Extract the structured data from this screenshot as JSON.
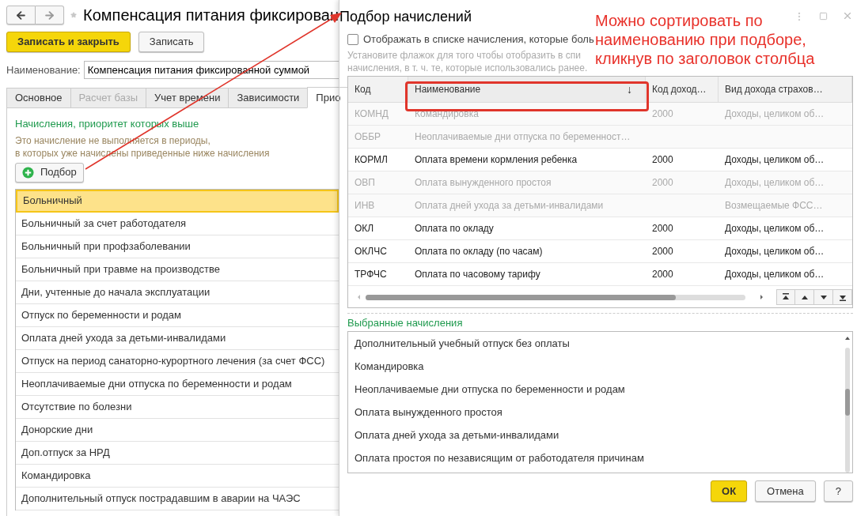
{
  "form": {
    "title": "Компенсация питания фиксирован",
    "buttons": [
      {
        "label": "Записать и закрыть",
        "kind": "primary"
      },
      {
        "label": "Записать",
        "kind": "normal"
      }
    ],
    "name_field": {
      "label": "Наименование:",
      "value": "Компенсация питания фиксированной суммой"
    },
    "tabs": [
      {
        "label": "Основное",
        "selected": false,
        "disabled": false
      },
      {
        "label": "Расчет базы",
        "selected": false,
        "disabled": true
      },
      {
        "label": "Учет времени",
        "selected": false,
        "disabled": false
      },
      {
        "label": "Зависимости",
        "selected": false,
        "disabled": false
      },
      {
        "label": "Прио",
        "selected": true,
        "disabled": false
      }
    ],
    "section_title": "Начисления, приоритет которых выше",
    "hint_lines": [
      "Это начисление не выполняется в периоды,",
      "в которых уже начислены приведенные ниже начисления"
    ],
    "pick_button": "Подбор",
    "items": [
      {
        "label": "Больничный",
        "selected": true
      },
      {
        "label": "Больничный за счет работодателя",
        "selected": false
      },
      {
        "label": "Больничный при профзаболевании",
        "selected": false
      },
      {
        "label": "Больничный при травме на производстве",
        "selected": false
      },
      {
        "label": "Дни, учтенные до начала эксплуатации",
        "selected": false
      },
      {
        "label": "Отпуск по беременности и родам",
        "selected": false
      },
      {
        "label": "Оплата дней ухода за детьми-инвалидами",
        "selected": false
      },
      {
        "label": "Отпуск на период санаторно-курортного лечения (за счет ФСС)",
        "selected": false
      },
      {
        "label": "Неоплачиваемые дни отпуска по беременности и родам",
        "selected": false
      },
      {
        "label": "Отсутствие по болезни",
        "selected": false
      },
      {
        "label": "Донорские дни",
        "selected": false
      },
      {
        "label": "Доп.отпуск за НРД",
        "selected": false
      },
      {
        "label": "Командировка",
        "selected": false
      },
      {
        "label": "Дополнительный отпуск пострадавшим в аварии на ЧАЭС",
        "selected": false
      }
    ]
  },
  "dialog": {
    "title": "Подбор начислений",
    "checkbox": {
      "label": "Отображать в списке начисления, которые боль",
      "checked": false
    },
    "hint_lines": [
      "Установите флажок для того чтобы отобразить в спи",
      "начисления, в т. ч. те, которые использовались ранее."
    ],
    "table": {
      "columns": [
        {
          "label": "Код"
        },
        {
          "label": "Наименование",
          "sort_mark": "↓"
        },
        {
          "label": "Код доход…"
        },
        {
          "label": "Вид дохода страхов…"
        }
      ],
      "rows": [
        {
          "cells": [
            "КОМНД",
            "Командировка",
            "2000",
            "Доходы, целиком об…"
          ],
          "disabled": true
        },
        {
          "cells": [
            "ОББР",
            "Неоплачиваемые дни отпуска по беременност…",
            "",
            ""
          ],
          "disabled": true
        },
        {
          "cells": [
            "КОРМЛ",
            "Оплата времени кормления ребенка",
            "2000",
            "Доходы, целиком об…"
          ],
          "disabled": false
        },
        {
          "cells": [
            "ОВП",
            "Оплата вынужденного простоя",
            "2000",
            "Доходы, целиком об…"
          ],
          "disabled": true
        },
        {
          "cells": [
            "ИНВ",
            "Оплата дней ухода за детьми-инвалидами",
            "",
            "Возмещаемые ФСС…"
          ],
          "disabled": true
        },
        {
          "cells": [
            "ОКЛ",
            "Оплата по окладу",
            "2000",
            "Доходы, целиком об…"
          ],
          "disabled": false
        },
        {
          "cells": [
            "ОКЛЧС",
            "Оплата по окладу (по часам)",
            "2000",
            "Доходы, целиком об…"
          ],
          "disabled": false
        },
        {
          "cells": [
            "ТРФЧС",
            "Оплата по часовому тарифу",
            "2000",
            "Доходы, целиком об…"
          ],
          "disabled": false
        }
      ]
    },
    "selected_title": "Выбранные начисления",
    "selected_items": [
      "Дополнительный учебный отпуск без оплаты",
      "Командировка",
      "Неоплачиваемые дни отпуска по беременности и родам",
      "Оплата вынужденного простоя",
      "Оплата дней ухода за детьми-инвалидами",
      "Оплата простоя по независящим от работодателя причинам"
    ],
    "buttons": [
      {
        "label": "ОК",
        "kind": "primary"
      },
      {
        "label": "Отмена",
        "kind": "normal"
      },
      {
        "label": "?",
        "kind": "normal"
      }
    ]
  },
  "annotation": {
    "lines": [
      "Можно сортировать по",
      "наименованию при подборе,",
      "кликнув по заголовок столбца"
    ]
  }
}
